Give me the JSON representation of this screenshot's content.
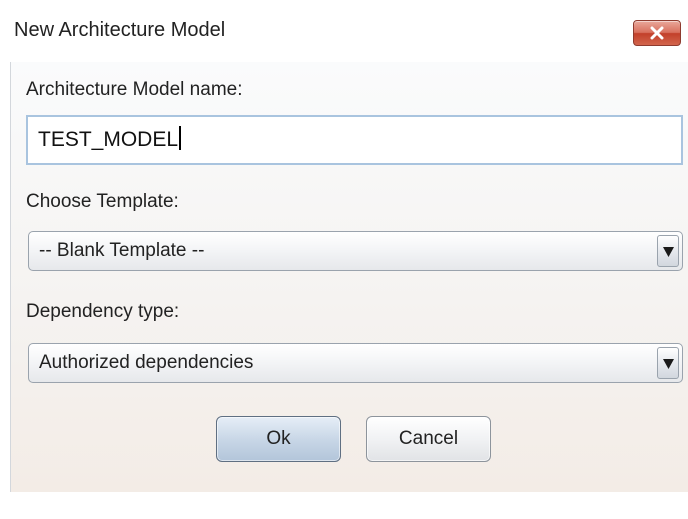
{
  "window": {
    "title": "New Architecture Model",
    "close_icon": "close-x-icon"
  },
  "form": {
    "name_label": "Architecture Model name:",
    "name_value": "TEST_MODEL",
    "template_label": "Choose Template:",
    "template_selected": "-- Blank Template --",
    "dependency_label": "Dependency type:",
    "dependency_selected": "Authorized dependencies"
  },
  "buttons": {
    "ok_label": "Ok",
    "cancel_label": "Cancel"
  },
  "colors": {
    "close_button": "#c2402a",
    "input_border": "#a9c4df",
    "ok_button": "#c9d7e7"
  }
}
